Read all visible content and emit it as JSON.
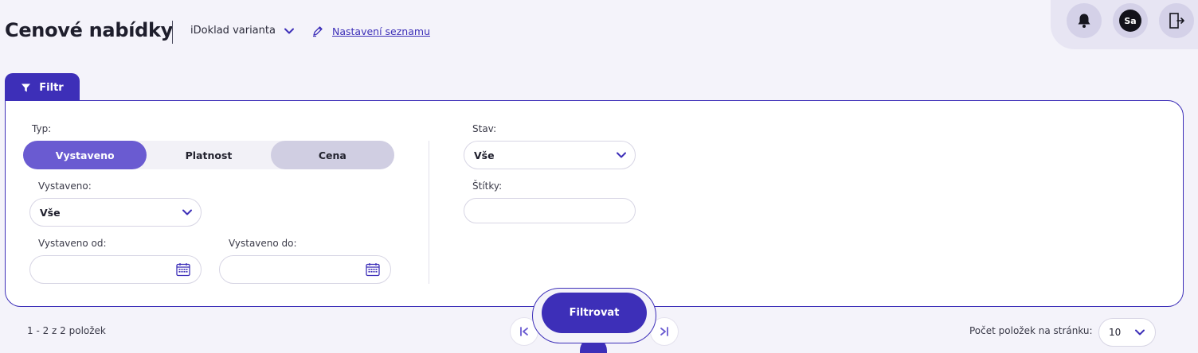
{
  "header": {
    "title": "Cenové nabídky",
    "variant_label": "iDoklad varianta",
    "settings_link": "Nastavení seznamu",
    "avatar_initials": "Sa"
  },
  "filter": {
    "tab_label": "Filtr",
    "type_label": "Typ:",
    "type_options": [
      "Vystaveno",
      "Platnost",
      "Cena"
    ],
    "type_selected": "Vystaveno",
    "issued_label": "Vystaveno:",
    "issued_value": "Vše",
    "issued_from_label": "Vystaveno od:",
    "issued_to_label": "Vystaveno do:",
    "state_label": "Stav:",
    "state_value": "Vše",
    "tags_label": "Štítky:",
    "submit_label": "Filtrovat"
  },
  "footer": {
    "items_count": "1 - 2 z 2 položek",
    "per_page_label": "Počet položek na stránku:",
    "per_page_value": "10"
  },
  "colors": {
    "accent": "#3d2fb8",
    "segment_active": "#6a5bd1",
    "segment_muted": "#d0cee2",
    "background": "#f4f3fa"
  }
}
